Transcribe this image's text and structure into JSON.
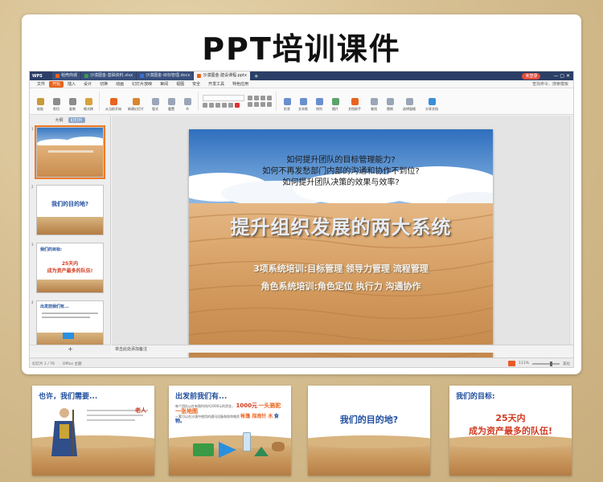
{
  "page_title": "PPT培训课件",
  "window": {
    "app_label": "WPS",
    "tabs": [
      {
        "label": "稻壳商城",
        "color": "#e8631e",
        "active": false
      },
      {
        "label": "沙漠图金·基础资料.xlsx",
        "color": "#3a9a45",
        "active": false
      },
      {
        "label": "沙漠图金-目标管理.docx",
        "color": "#3b6fcf",
        "active": false
      },
      {
        "label": "沙漠图金·建设课程.pptx",
        "color": "#e8631e",
        "active": true
      }
    ],
    "new_tab": "+",
    "login_label": "未登录",
    "window_controls": "— ▢ ✕",
    "menu": {
      "file": "文件",
      "items": [
        "开始",
        "插入",
        "设计",
        "切换",
        "动画",
        "幻灯片放映",
        "审阅",
        "视图",
        "安全",
        "开发工具",
        "特色应用"
      ],
      "active_index": 0,
      "search": "查找命令、搜索模板"
    },
    "ribbon": {
      "paste": "粘贴",
      "cut": "剪切",
      "copy": "复制",
      "format_painter": "格式刷",
      "from_current": "从当前开始",
      "new_slide": "新建幻灯片",
      "layout": "版式",
      "reset": "重置",
      "section": "节",
      "shapes": "形状",
      "text_box": "文本框",
      "arrange": "排列",
      "picture": "图片",
      "doc_assistant": "文档助手",
      "find": "查找",
      "replace": "替换",
      "select_pane": "选择窗格",
      "share": "分享文档"
    },
    "left_pane": {
      "tabs": [
        "大纲",
        "幻灯片"
      ],
      "active_tab": 1,
      "add_label": "+",
      "slide_numbers": [
        "1",
        "2",
        "3",
        "4"
      ],
      "thumb2_text": "我们的目的地?",
      "thumb3_title": "我们的目标:",
      "thumb3_line1": "25天内",
      "thumb3_line2": "成为资产最多的队伍!",
      "thumb4_title": "出发前我们有..."
    },
    "slide": {
      "questions": [
        "如何提升团队的目标管理能力?",
        "如何不再发愁部门内部的沟通和协作不到位?",
        "如何提升团队决策的效果与效率?"
      ],
      "main_title": "提升组织发展的两大系统",
      "line1": "3项系统培训:目标管理 领导力管理 流程管理",
      "line2": "角色系统培训:角色定位 执行力 沟通协作"
    },
    "notes_placeholder": "单击此处添加备注",
    "status": {
      "slide_info": "幻灯片 1 / 76",
      "theme": "Office 主题",
      "zoom": "111%",
      "beautify": "美化"
    }
  },
  "preview_cards": [
    {
      "title": "也许，我们需要...",
      "subtitle": "",
      "highlight": "老人"
    },
    {
      "title": "出发前我们有...",
      "body1": "每个团队以在有限时间内1000元的资金，",
      "body1_red": "1000元",
      "body1_orange": "一头骆驼一张地图",
      "body2": "一套可以在沙漠中使用的通讯设备和保命物资",
      "body2_orange": "帐篷 指南针 水",
      "body3": "食物。"
    },
    {
      "title": "我们的目的地?"
    },
    {
      "title": "我们的目标:",
      "line1": "25天内",
      "line2": "成为资产最多的队伍!"
    }
  ]
}
